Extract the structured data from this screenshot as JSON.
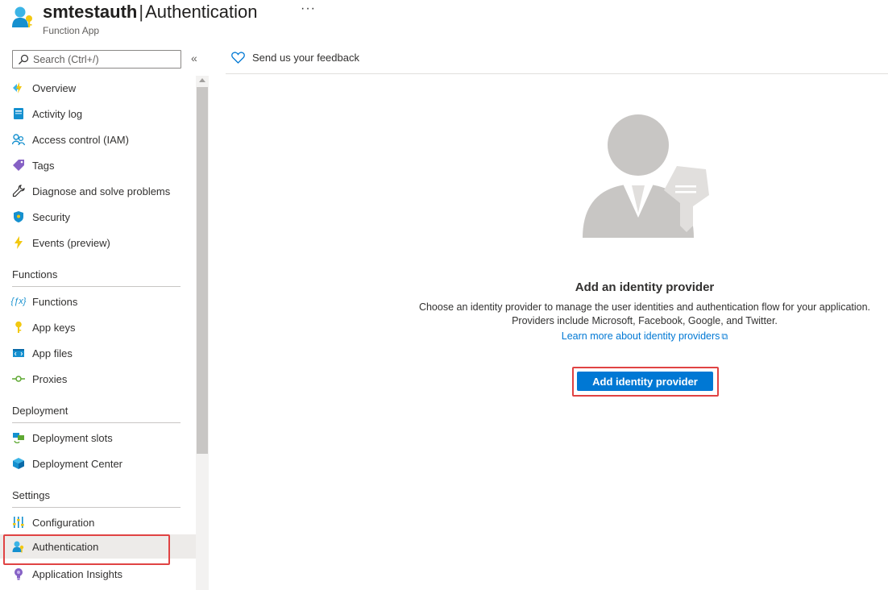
{
  "header": {
    "resource_name": "smtestauth",
    "separator": "|",
    "page_title": "Authentication",
    "more": "···",
    "resource_type": "Function App"
  },
  "sidebar": {
    "search_placeholder": "Search (Ctrl+/)",
    "collapse": "«",
    "top_items": [
      {
        "label": "Overview",
        "icon": "lightning-globe-icon"
      },
      {
        "label": "Activity log",
        "icon": "activity-log-icon"
      },
      {
        "label": "Access control (IAM)",
        "icon": "people-icon"
      },
      {
        "label": "Tags",
        "icon": "tag-icon"
      },
      {
        "label": "Diagnose and solve problems",
        "icon": "wrench-icon"
      },
      {
        "label": "Security",
        "icon": "shield-icon"
      },
      {
        "label": "Events (preview)",
        "icon": "bolt-icon"
      }
    ],
    "sections": [
      {
        "title": "Functions",
        "items": [
          {
            "label": "Functions",
            "icon": "function-icon"
          },
          {
            "label": "App keys",
            "icon": "key-icon"
          },
          {
            "label": "App files",
            "icon": "code-file-icon"
          },
          {
            "label": "Proxies",
            "icon": "proxy-icon"
          }
        ]
      },
      {
        "title": "Deployment",
        "items": [
          {
            "label": "Deployment slots",
            "icon": "slots-icon"
          },
          {
            "label": "Deployment Center",
            "icon": "cube-icon"
          }
        ]
      },
      {
        "title": "Settings",
        "items": [
          {
            "label": "Configuration",
            "icon": "sliders-icon"
          },
          {
            "label": "Authentication",
            "icon": "user-key-icon",
            "active": true
          },
          {
            "label": "Application Insights",
            "icon": "lightbulb-icon"
          }
        ]
      }
    ]
  },
  "toolbar": {
    "feedback_label": "Send us your feedback"
  },
  "empty_state": {
    "title": "Add an identity provider",
    "description_line1": "Choose an identity provider to manage the user identities and authentication flow for your application.",
    "description_line2": "Providers include Microsoft, Facebook, Google, and Twitter.",
    "learn_more": "Learn more about identity providers",
    "button_label": "Add identity provider"
  },
  "colors": {
    "accent": "#0078d4",
    "highlight_box": "#e04343",
    "active_nav": "#edebe9"
  }
}
